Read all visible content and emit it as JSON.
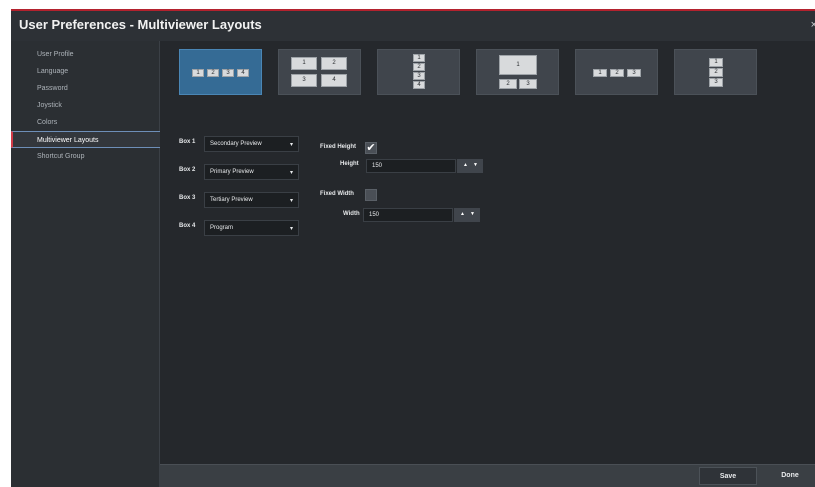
{
  "window": {
    "title": "User Preferences - Multiviewer Layouts",
    "close_glyph": "×"
  },
  "sidebar": {
    "items": [
      {
        "label": "User Profile"
      },
      {
        "label": "Language"
      },
      {
        "label": "Password"
      },
      {
        "label": "Joystick"
      },
      {
        "label": "Colors"
      },
      {
        "label": "Multiviewer Layouts",
        "active": true
      },
      {
        "label": "Shortcut Group"
      }
    ]
  },
  "layouts": {
    "selected_index": 0,
    "tiles": [
      {
        "cells": [
          "1",
          "2",
          "3",
          "4"
        ]
      },
      {
        "cells": [
          "1",
          "2",
          "3",
          "4"
        ]
      },
      {
        "cells": [
          "1",
          "2",
          "3",
          "4"
        ]
      },
      {
        "cells": [
          "1",
          "2",
          "3"
        ]
      },
      {
        "cells": [
          "1",
          "2",
          "3"
        ]
      },
      {
        "cells": [
          "1",
          "2",
          "3"
        ]
      }
    ]
  },
  "boxes": [
    {
      "label": "Box 1",
      "value": "Secondary Preview"
    },
    {
      "label": "Box 2",
      "value": "Primary Preview"
    },
    {
      "label": "Box 3",
      "value": "Tertiary Preview"
    },
    {
      "label": "Box 4",
      "value": "Program"
    }
  ],
  "size": {
    "fixed_height_label": "Fixed Height",
    "fixed_height_checked": true,
    "height_label": "Height",
    "height_value": "150",
    "fixed_width_label": "Fixed Width",
    "fixed_width_checked": false,
    "width_label": "Width",
    "width_value": "150"
  },
  "glyphs": {
    "caret": "▾",
    "up": "▲",
    "down": "▼",
    "check": "✔"
  },
  "footer": {
    "save_label": "Save",
    "done_label": "Done"
  },
  "colors": {
    "accent": "#b3222e",
    "selected_tile": "#356b95",
    "background": "#25282c"
  }
}
